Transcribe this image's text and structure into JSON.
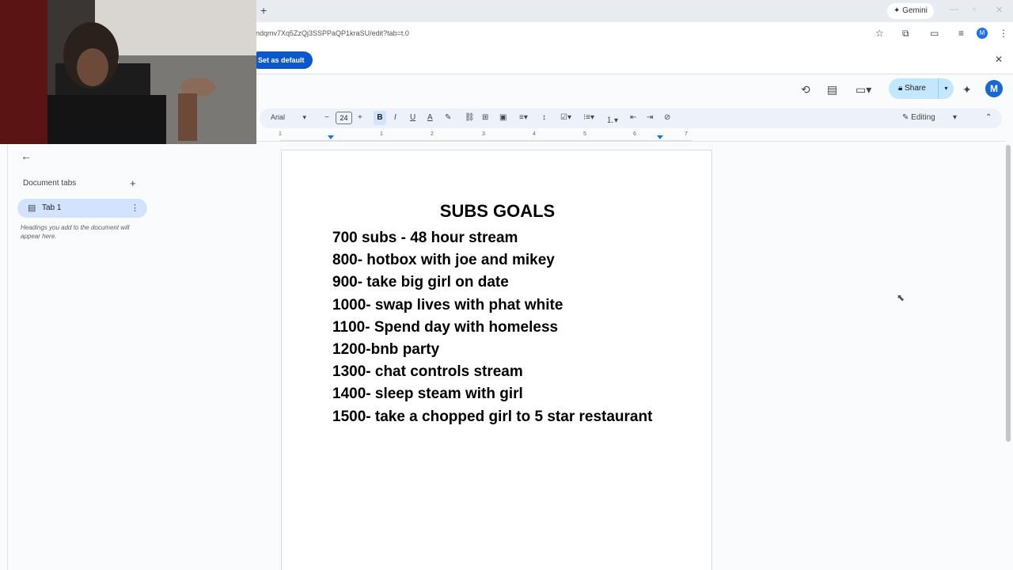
{
  "browser": {
    "gemini_label": "Gemini",
    "url": "ndqmv7Xq5ZzQj3SSPPaQP1kraSU/edit?tab=t.0",
    "set_default_label": "Set as default",
    "profile_initial": "M"
  },
  "header": {
    "share_label": "Share",
    "avatar_initial": "M"
  },
  "toolbar": {
    "font": "Arial",
    "font_size": "24",
    "bold": "B",
    "italic": "I",
    "underline": "U",
    "text_color": "A",
    "mode": "Editing"
  },
  "ruler": {
    "numbers": [
      "1",
      "1",
      "2",
      "3",
      "4",
      "5",
      "6",
      "7"
    ]
  },
  "sidebar": {
    "title": "Document tabs",
    "tab_label": "Tab 1",
    "hint": "Headings you add to the document will appear here."
  },
  "document": {
    "title": "SUBS GOALS",
    "lines": [
      "700 subs - 48 hour stream",
      "800- hotbox with joe and mikey",
      "900- take big girl on date",
      "1000- swap lives with phat white",
      "1100- Spend day with homeless",
      "1200-bnb party",
      "1300- chat controls stream",
      "1400- sleep steam with girl",
      "1500- take a chopped girl to 5 star restaurant"
    ]
  },
  "colors": {
    "accent": "#0b57d0",
    "share_bg": "#c2e7ff",
    "tab_active_bg": "#d3e3fd",
    "toolbar_bg": "#edf2fa"
  }
}
